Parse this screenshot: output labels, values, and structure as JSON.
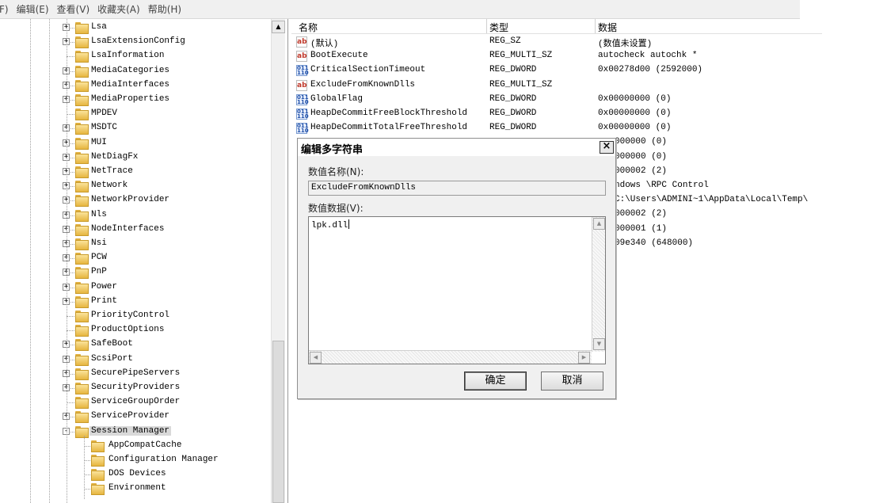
{
  "menu": [
    "F)",
    "编辑(E)",
    "查看(V)",
    "收藏夹(A)",
    "帮助(H)"
  ],
  "tree": {
    "items": [
      {
        "label": "Lsa",
        "expand": "+"
      },
      {
        "label": "LsaExtensionConfig",
        "expand": "+"
      },
      {
        "label": "LsaInformation",
        "expand": ""
      },
      {
        "label": "MediaCategories",
        "expand": "+"
      },
      {
        "label": "MediaInterfaces",
        "expand": "+"
      },
      {
        "label": "MediaProperties",
        "expand": "+"
      },
      {
        "label": "MPDEV",
        "expand": ""
      },
      {
        "label": "MSDTC",
        "expand": "+"
      },
      {
        "label": "MUI",
        "expand": "+"
      },
      {
        "label": "NetDiagFx",
        "expand": "+"
      },
      {
        "label": "NetTrace",
        "expand": "+"
      },
      {
        "label": "Network",
        "expand": "+"
      },
      {
        "label": "NetworkProvider",
        "expand": "+"
      },
      {
        "label": "Nls",
        "expand": "+"
      },
      {
        "label": "NodeInterfaces",
        "expand": "+"
      },
      {
        "label": "Nsi",
        "expand": "+"
      },
      {
        "label": "PCW",
        "expand": "+"
      },
      {
        "label": "PnP",
        "expand": "+"
      },
      {
        "label": "Power",
        "expand": "+"
      },
      {
        "label": "Print",
        "expand": "+"
      },
      {
        "label": "PriorityControl",
        "expand": ""
      },
      {
        "label": "ProductOptions",
        "expand": ""
      },
      {
        "label": "SafeBoot",
        "expand": "+"
      },
      {
        "label": "ScsiPort",
        "expand": "+"
      },
      {
        "label": "SecurePipeServers",
        "expand": "+"
      },
      {
        "label": "SecurityProviders",
        "expand": "+"
      },
      {
        "label": "ServiceGroupOrder",
        "expand": ""
      },
      {
        "label": "ServiceProvider",
        "expand": "+"
      },
      {
        "label": "Session Manager",
        "expand": "-",
        "selected": true
      }
    ],
    "children": [
      "AppCompatCache",
      "Configuration Manager",
      "DOS Devices",
      "Environment"
    ]
  },
  "list": {
    "headers": [
      "名称",
      "类型",
      "数据"
    ],
    "rows": [
      {
        "icon": "ab",
        "name": "(默认)",
        "type": "REG_SZ",
        "data": "(数值未设置)"
      },
      {
        "icon": "ab",
        "name": "BootExecute",
        "type": "REG_MULTI_SZ",
        "data": "autocheck autochk *"
      },
      {
        "icon": "dw",
        "name": "CriticalSectionTimeout",
        "type": "REG_DWORD",
        "data": "0x00278d00 (2592000)"
      },
      {
        "icon": "ab",
        "name": "ExcludeFromKnownDlls",
        "type": "REG_MULTI_SZ",
        "data": ""
      },
      {
        "icon": "dw",
        "name": "GlobalFlag",
        "type": "REG_DWORD",
        "data": "0x00000000 (0)"
      },
      {
        "icon": "dw",
        "name": "HeapDeCommitFreeBlockThreshold",
        "type": "REG_DWORD",
        "data": "0x00000000 (0)"
      },
      {
        "icon": "dw",
        "name": "HeapDeCommitTotalFreeThreshold",
        "type": "REG_DWORD",
        "data": "0x00000000 (0)"
      }
    ],
    "partial_data": [
      "000000 (0)",
      "000000 (0)",
      "000002 (2)",
      "ndows \\RPC Control",
      "C:\\Users\\ADMINI~1\\AppData\\Local\\Temp\\",
      "000002 (2)",
      "000001 (1)",
      "09e340 (648000)"
    ]
  },
  "dialog": {
    "title": "编辑多字符串",
    "close": "×",
    "name_label": "数值名称(N):",
    "name_value": "ExcludeFromKnownDlls",
    "data_label": "数值数据(V):",
    "data_value": "lpk.dll",
    "ok": "确定",
    "cancel": "取消"
  }
}
